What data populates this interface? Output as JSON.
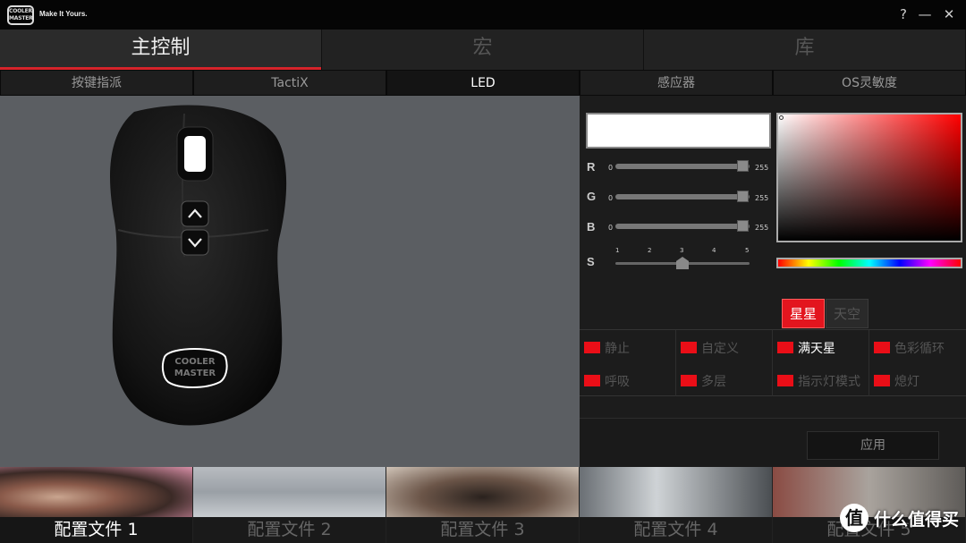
{
  "titlebar": {
    "logo_text": "COOLER MASTER",
    "tagline": "Make It Yours.",
    "help": "?",
    "minimize": "—",
    "close": "✕"
  },
  "main_tabs": [
    {
      "label": "主控制",
      "active": true
    },
    {
      "label": "宏",
      "active": false
    },
    {
      "label": "库",
      "active": false
    }
  ],
  "sub_tabs": [
    {
      "label": "按键指派",
      "active": false
    },
    {
      "label": "TactiX",
      "active": false
    },
    {
      "label": "LED",
      "active": true
    },
    {
      "label": "感应器",
      "active": false
    },
    {
      "label": "OS灵敏度",
      "active": false
    }
  ],
  "mouse": {
    "logo_text": "COOLER MASTER"
  },
  "led": {
    "swatch_color": "#ffffff",
    "sliders": [
      {
        "label": "R",
        "min": "0",
        "max": "255",
        "value": 255
      },
      {
        "label": "G",
        "min": "0",
        "max": "255",
        "value": 255
      },
      {
        "label": "B",
        "min": "0",
        "max": "255",
        "value": 255
      }
    ],
    "speed": {
      "label": "S",
      "ticks": [
        "1",
        "2",
        "3",
        "4",
        "5"
      ],
      "value": 3
    },
    "mode_tabs": [
      {
        "label": "星星",
        "active": true
      },
      {
        "label": "天空",
        "active": false
      }
    ],
    "effects": [
      {
        "label": "静止",
        "selected": false
      },
      {
        "label": "自定义",
        "selected": false
      },
      {
        "label": "满天星",
        "selected": true
      },
      {
        "label": "色彩循环",
        "selected": false
      },
      {
        "label": "呼吸",
        "selected": false
      },
      {
        "label": "多层",
        "selected": false
      },
      {
        "label": "指示灯模式",
        "selected": false
      },
      {
        "label": "熄灯",
        "selected": false
      }
    ],
    "apply_label": "应用"
  },
  "profiles": [
    {
      "label": "配置文件 1",
      "active": true
    },
    {
      "label": "配置文件 2",
      "active": false
    },
    {
      "label": "配置文件 3",
      "active": false
    },
    {
      "label": "配置文件 4",
      "active": false
    },
    {
      "label": "配置文件 5",
      "active": false
    }
  ],
  "watermark": {
    "icon": "值",
    "text": "什么值得买"
  },
  "colors": {
    "accent": "#d6232a",
    "effect_box": "#ea0e17",
    "preview_bg": "#5b5e62"
  }
}
